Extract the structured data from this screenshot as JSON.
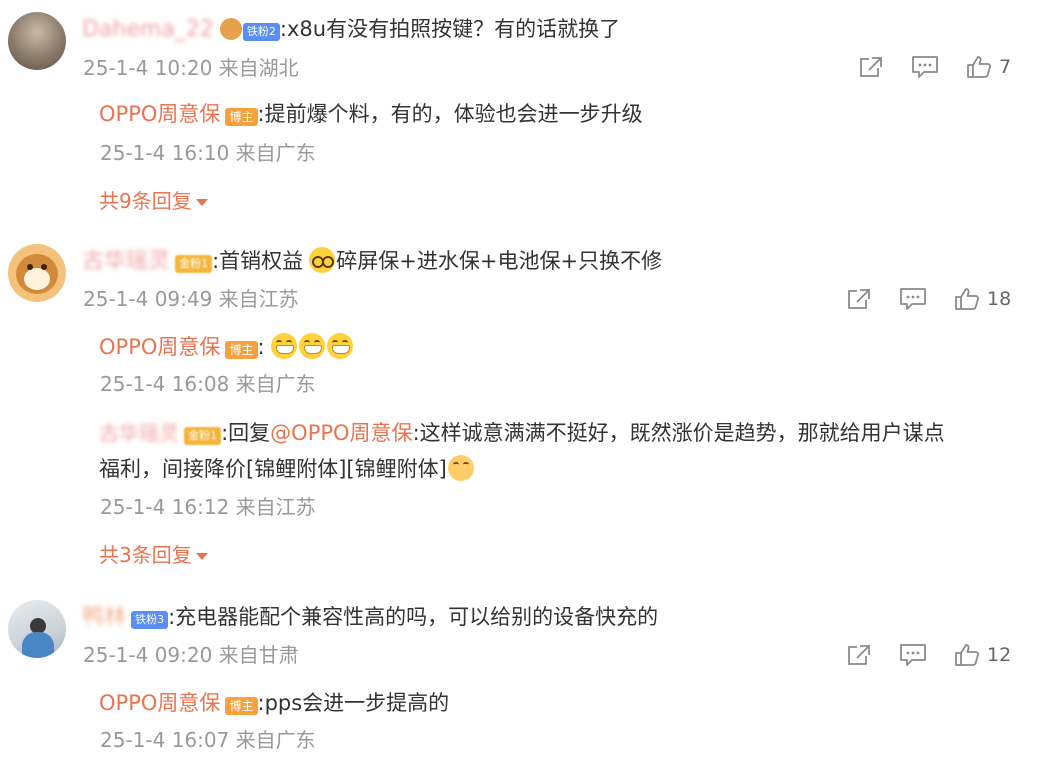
{
  "comments": [
    {
      "nickname": "Dahema_22",
      "badge": "铁粉2",
      "text": ":x8u有没有拍照按键？有的话就换了",
      "time": "25-1-4 10:20 来自湖北",
      "likes": "7",
      "replies": [
        {
          "name": "OPPO周意保",
          "badge": "博主",
          "text": ":提前爆个料，有的，体验也会进一步升级",
          "time": "25-1-4 16:10 来自广东"
        }
      ],
      "more": "共9条回复"
    },
    {
      "nickname": "古华瑶灵",
      "badge": "金粉1",
      "text_before": ":首销权益",
      "text_after": "碎屏保+进水保+电池保+只换不修",
      "time": "25-1-4 09:49 来自江苏",
      "likes": "18",
      "replies": [
        {
          "name": "OPPO周意保",
          "badge": "博主",
          "text": ":",
          "time": "25-1-4 16:08 来自广东"
        },
        {
          "name": "古华瑶灵",
          "badge": "金粉1",
          "reply_prefix": ":回复",
          "mention": "@OPPO周意保",
          "text": ":这样诚意满满不挺好，既然涨价是趋势，那就给用户谋点",
          "text2": "福利，间接降价[锦鲤附体][锦鲤附体]",
          "time": "25-1-4 16:12 来自江苏"
        }
      ],
      "more": "共3条回复"
    },
    {
      "nickname": "鸭林",
      "badge": "铁粉3",
      "text": ":充电器能配个兼容性高的吗，可以给别的设备快充的",
      "time": "25-1-4 09:20 来自甘肃",
      "likes": "12",
      "replies": [
        {
          "name": "OPPO周意保",
          "badge": "博主",
          "text": ":pps会进一步提高的",
          "time": "25-1-4 16:07 来自广东"
        }
      ]
    }
  ],
  "icons": {
    "share": "share-icon",
    "comment": "comment-icon",
    "like": "thumbs-up-icon",
    "expand": "chevron-down-icon"
  },
  "colors": {
    "accent": "#eb7350",
    "meta": "#999999",
    "badge_blue": "#5a8ef5",
    "badge_host": "#f7a13c"
  }
}
